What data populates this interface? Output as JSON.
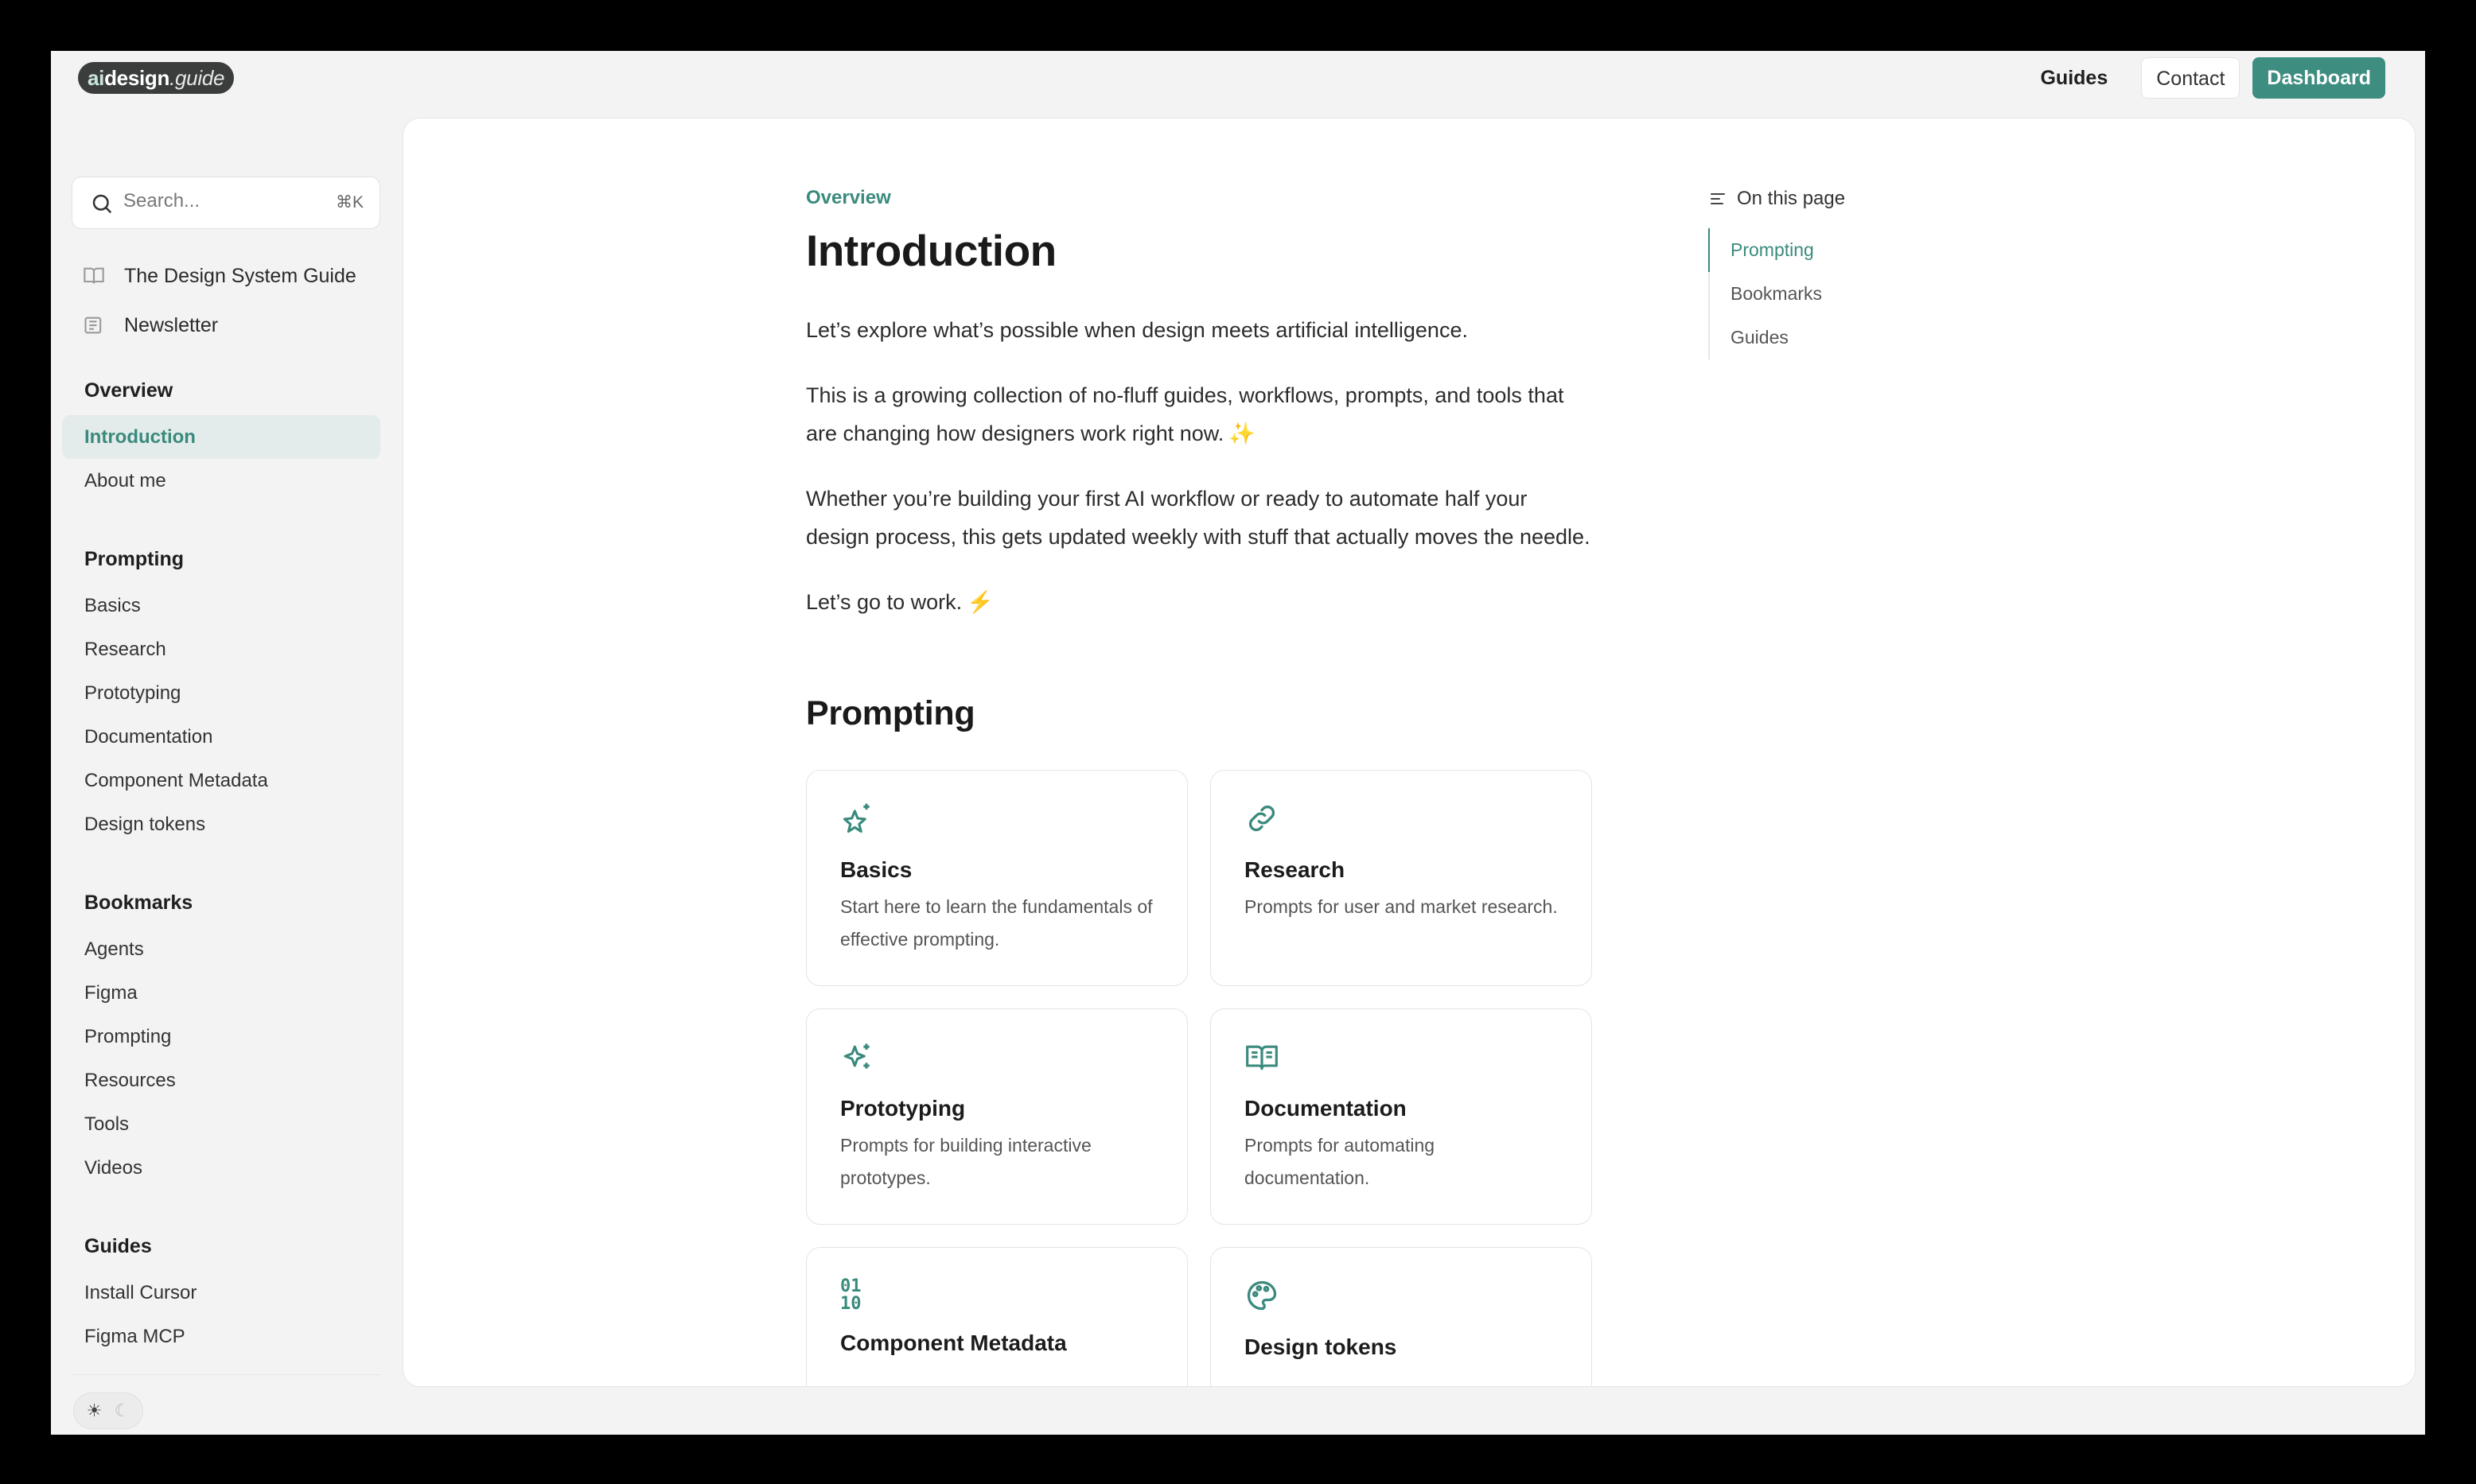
{
  "brand": {
    "logo_part1": "ai",
    "logo_part2": "design",
    "logo_part3": ".guide"
  },
  "topnav": {
    "guides": "Guides",
    "contact": "Contact",
    "dashboard": "Dashboard"
  },
  "search": {
    "placeholder": "Search...",
    "shortcut": "⌘K"
  },
  "sidebar": {
    "top_links": [
      {
        "label": "The Design System Guide",
        "icon": "book-icon"
      },
      {
        "label": "Newsletter",
        "icon": "newspaper-icon"
      }
    ],
    "groups": [
      {
        "heading": "Overview",
        "items": [
          "Introduction",
          "About me"
        ],
        "active": "Introduction"
      },
      {
        "heading": "Prompting",
        "items": [
          "Basics",
          "Research",
          "Prototyping",
          "Documentation",
          "Component Metadata",
          "Design tokens"
        ]
      },
      {
        "heading": "Bookmarks",
        "items": [
          "Agents",
          "Figma",
          "Prompting",
          "Resources",
          "Tools",
          "Videos"
        ]
      },
      {
        "heading": "Guides",
        "items": [
          "Install Cursor",
          "Figma MCP"
        ]
      }
    ],
    "theme_toggle": {
      "light": "☀",
      "dark": "☾"
    }
  },
  "article": {
    "eyebrow": "Overview",
    "title": "Introduction",
    "paragraphs": [
      "Let’s explore what’s possible when design meets artificial intelligence.",
      "This is a growing collection of no-fluff guides, workflows, prompts, and tools that are changing how designers work right now.",
      "Whether you’re building your first AI workflow or ready to automate half your design process, this gets updated weekly with stuff that actually moves the needle.",
      "Let’s go to work."
    ],
    "p2_emoji": "✨",
    "p4_emoji": "⚡",
    "section_title": "Prompting",
    "cards": [
      {
        "title": "Basics",
        "desc": "Start here to learn the fundamentals of effective prompting.",
        "icon": "sparkle-star-icon"
      },
      {
        "title": "Research",
        "desc": "Prompts for user and market research.",
        "icon": "link-icon"
      },
      {
        "title": "Prototyping",
        "desc": "Prompts for building interactive prototypes.",
        "icon": "sparkles-icon"
      },
      {
        "title": "Documentation",
        "desc": "Prompts for automating documentation.",
        "icon": "open-book-icon"
      },
      {
        "title": "Component Metadata",
        "desc": "",
        "icon": "binary-icon",
        "icon_text": "01\n10"
      },
      {
        "title": "Design tokens",
        "desc": "",
        "icon": "palette-icon"
      }
    ]
  },
  "toc": {
    "heading": "On this page",
    "items": [
      "Prompting",
      "Bookmarks",
      "Guides"
    ],
    "active": "Prompting"
  },
  "colors": {
    "accent": "#3d8d80",
    "accent_text": "#3a8a7d",
    "active_bg": "#e3ecea"
  }
}
